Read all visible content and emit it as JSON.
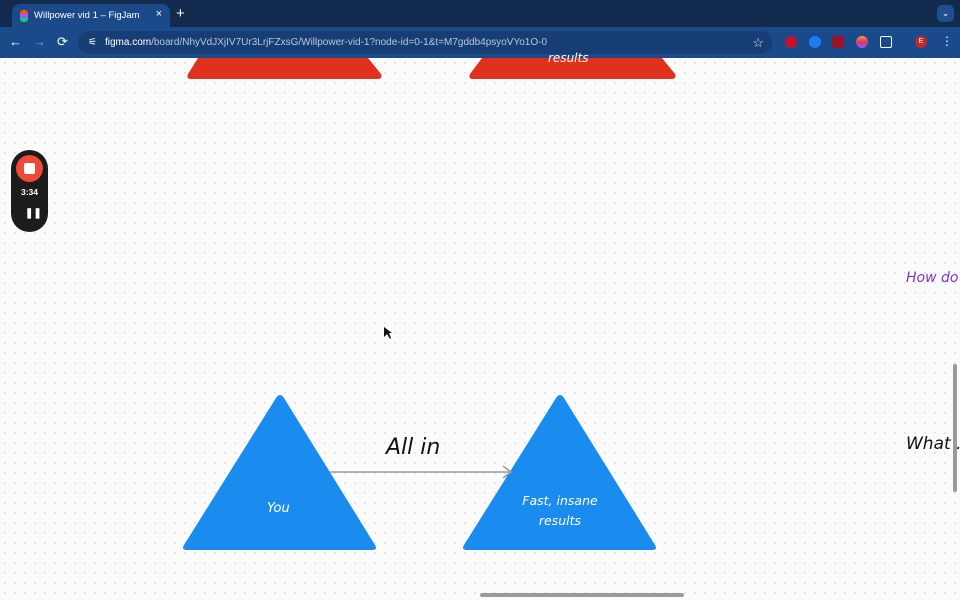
{
  "browser": {
    "tab_title": "Willpower vid 1 – FigJam",
    "close": "×",
    "new_tab": "+",
    "tab_menu": "⌄",
    "back": "←",
    "forward": "→",
    "reload": "⟳",
    "url_host": "figma.com",
    "url_path": "/board/NhyVdJXjIV7Ur3LrjFZxsG/Willpower-vid-1?node-id=0-1&t=M7gddb4psyoVYo1O-0",
    "bookmark": "☆",
    "profile_initial": "E",
    "menu": "⋮"
  },
  "recorder": {
    "time": "3:34",
    "pause": "❚❚"
  },
  "board": {
    "top_right_shape_text": "results",
    "arrow_label": "All in",
    "left_triangle_text": "You",
    "right_triangle_text_1": "Fast, insane",
    "right_triangle_text_2": "results",
    "side_note_1": "How do",
    "side_note_2": "What ."
  },
  "colors": {
    "triangle_blue": "#1a8cf0",
    "trapezoid_red": "#e0301e",
    "purple_text": "#7b35c9"
  }
}
